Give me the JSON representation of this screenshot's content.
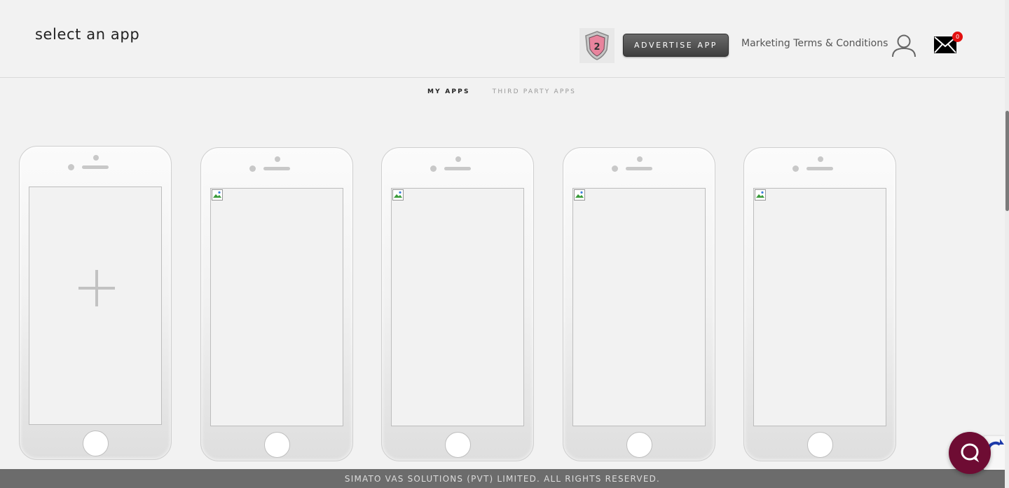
{
  "header": {
    "title": "select an app",
    "advertise_label": "ADVERTISE APP",
    "terms_label": "Marketing Terms & Conditions",
    "badge_number": "2",
    "mail_count": "0"
  },
  "tabs": [
    {
      "label": "MY APPS",
      "active": true
    },
    {
      "label": "THIRD PARTY APPS",
      "active": false
    }
  ],
  "apps": [
    {
      "type": "add",
      "icon": "plus-icon"
    },
    {
      "type": "app",
      "icon": "broken-image-icon"
    },
    {
      "type": "app",
      "icon": "broken-image-icon"
    },
    {
      "type": "app",
      "icon": "broken-image-icon"
    },
    {
      "type": "app",
      "icon": "broken-image-icon"
    }
  ],
  "footer": {
    "text": "SIMATO VAS SOLUTIONS (PVT) LIMITED. ALL RIGHTS RESERVED."
  },
  "icons": {
    "user": "user-icon",
    "mail": "mail-icon",
    "chat": "chat-icon"
  },
  "colors": {
    "background": "#f2f2f2",
    "footer": "#6c6c6c",
    "button": "#4a4a4a",
    "chat": "#6e0c33",
    "badge": "#e3100f"
  }
}
